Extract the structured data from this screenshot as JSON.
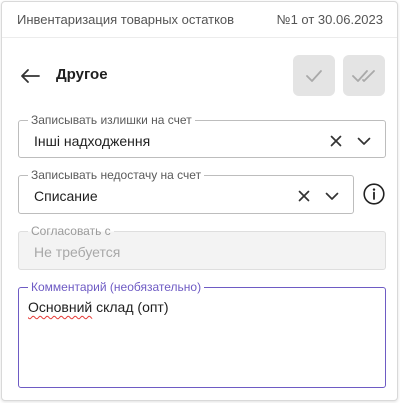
{
  "document": {
    "title": "Инвентаризация товарных остатков",
    "number": "№1 от 30.06.2023"
  },
  "header": {
    "title": "Другое"
  },
  "surplus_account": {
    "label": "Записывать излишки на счет",
    "value": "Інші надходження"
  },
  "shortage_account": {
    "label": "Записывать недостачу на счет",
    "value": "Списание"
  },
  "approval": {
    "label": "Согласовать с",
    "placeholder": "Не требуется"
  },
  "comment": {
    "label": "Комментарий (необязательно)",
    "value_word1": "Основний",
    "value_rest": " склад (опт)"
  },
  "colors": {
    "accent": "#6e5bc4",
    "spellcheck": "#e53935",
    "button_bg": "#e4e4e4"
  },
  "icons": [
    "arrow-left-icon",
    "check-icon",
    "double-check-icon",
    "clear-x-icon",
    "chevron-down-icon",
    "info-icon"
  ]
}
